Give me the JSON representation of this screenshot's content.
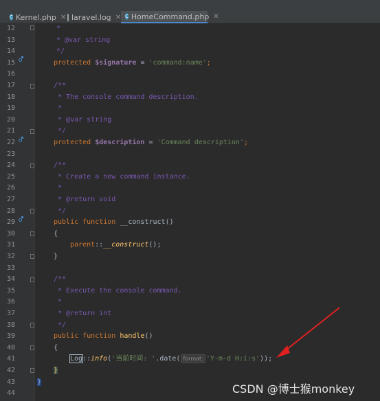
{
  "tabs": [
    {
      "label": "Kernel.php",
      "icon": "php-file-icon",
      "active": false
    },
    {
      "label": "laravel.log",
      "icon": "log-file-icon",
      "active": false
    },
    {
      "label": "HomeCommand.php",
      "icon": "php-file-icon",
      "active": true
    }
  ],
  "line_numbers": [
    "12",
    "13",
    "14",
    "15",
    "16",
    "17",
    "18",
    "19",
    "20",
    "21",
    "22",
    "23",
    "24",
    "25",
    "26",
    "27",
    "28",
    "29",
    "30",
    "31",
    "32",
    "33",
    "34",
    "35",
    "36",
    "37",
    "38",
    "39",
    "40",
    "41",
    "42",
    "43",
    "44"
  ],
  "code": {
    "l12": "*",
    "l13_tag": "* @var",
    "l13_type": " string",
    "l14": "*/",
    "l15_kw": "protected ",
    "l15_var": "$signature",
    "l15_eq": " = ",
    "l15_str": "'command:name'",
    "l15_end": ";",
    "l17": "/**",
    "l18": " * The console command description.",
    "l19": " *",
    "l20_tag": " * @var",
    "l20_type": " string",
    "l21": " */",
    "l22_kw": "protected ",
    "l22_var": "$description",
    "l22_eq": " = ",
    "l22_str": "'Command description'",
    "l22_end": ";",
    "l24": "/**",
    "l25": " * Create a new command instance.",
    "l26": " *",
    "l27_tag": " * @return",
    "l27_type": " void",
    "l28": " */",
    "l29_kw": "public function ",
    "l29_fn": "__construct",
    "l29_end": "()",
    "l30": "{",
    "l31_parent": "parent",
    "l31_sep": "::",
    "l31_fn": "__construct",
    "l31_end": "();",
    "l32": "}",
    "l34": "/**",
    "l35": " * Execute the console command.",
    "l36": " *",
    "l37_tag": " * @return",
    "l37_type": " int",
    "l38": " */",
    "l39_kw": "public function ",
    "l39_fn": "handle",
    "l39_end": "()",
    "l40": "{",
    "l41_class": "Log",
    "l41_sep": "::",
    "l41_meth": "info",
    "l41_open": "(",
    "l41_str": "'当前时间: '",
    "l41_dot": ".date(",
    "l41_hint": "format:",
    "l41_str2": "'Y-m-d H:i:s'",
    "l41_end": "));",
    "l42": "}",
    "l43": "}"
  },
  "watermark": "CSDN @博士猴monkey",
  "colors": {
    "background": "#2b2b2b",
    "keyword": "#cc7832",
    "string": "#6a8759",
    "doc": "#7a58b3",
    "variable": "#9876aa",
    "function": "#ffc66d",
    "arrow": "#e02020"
  }
}
